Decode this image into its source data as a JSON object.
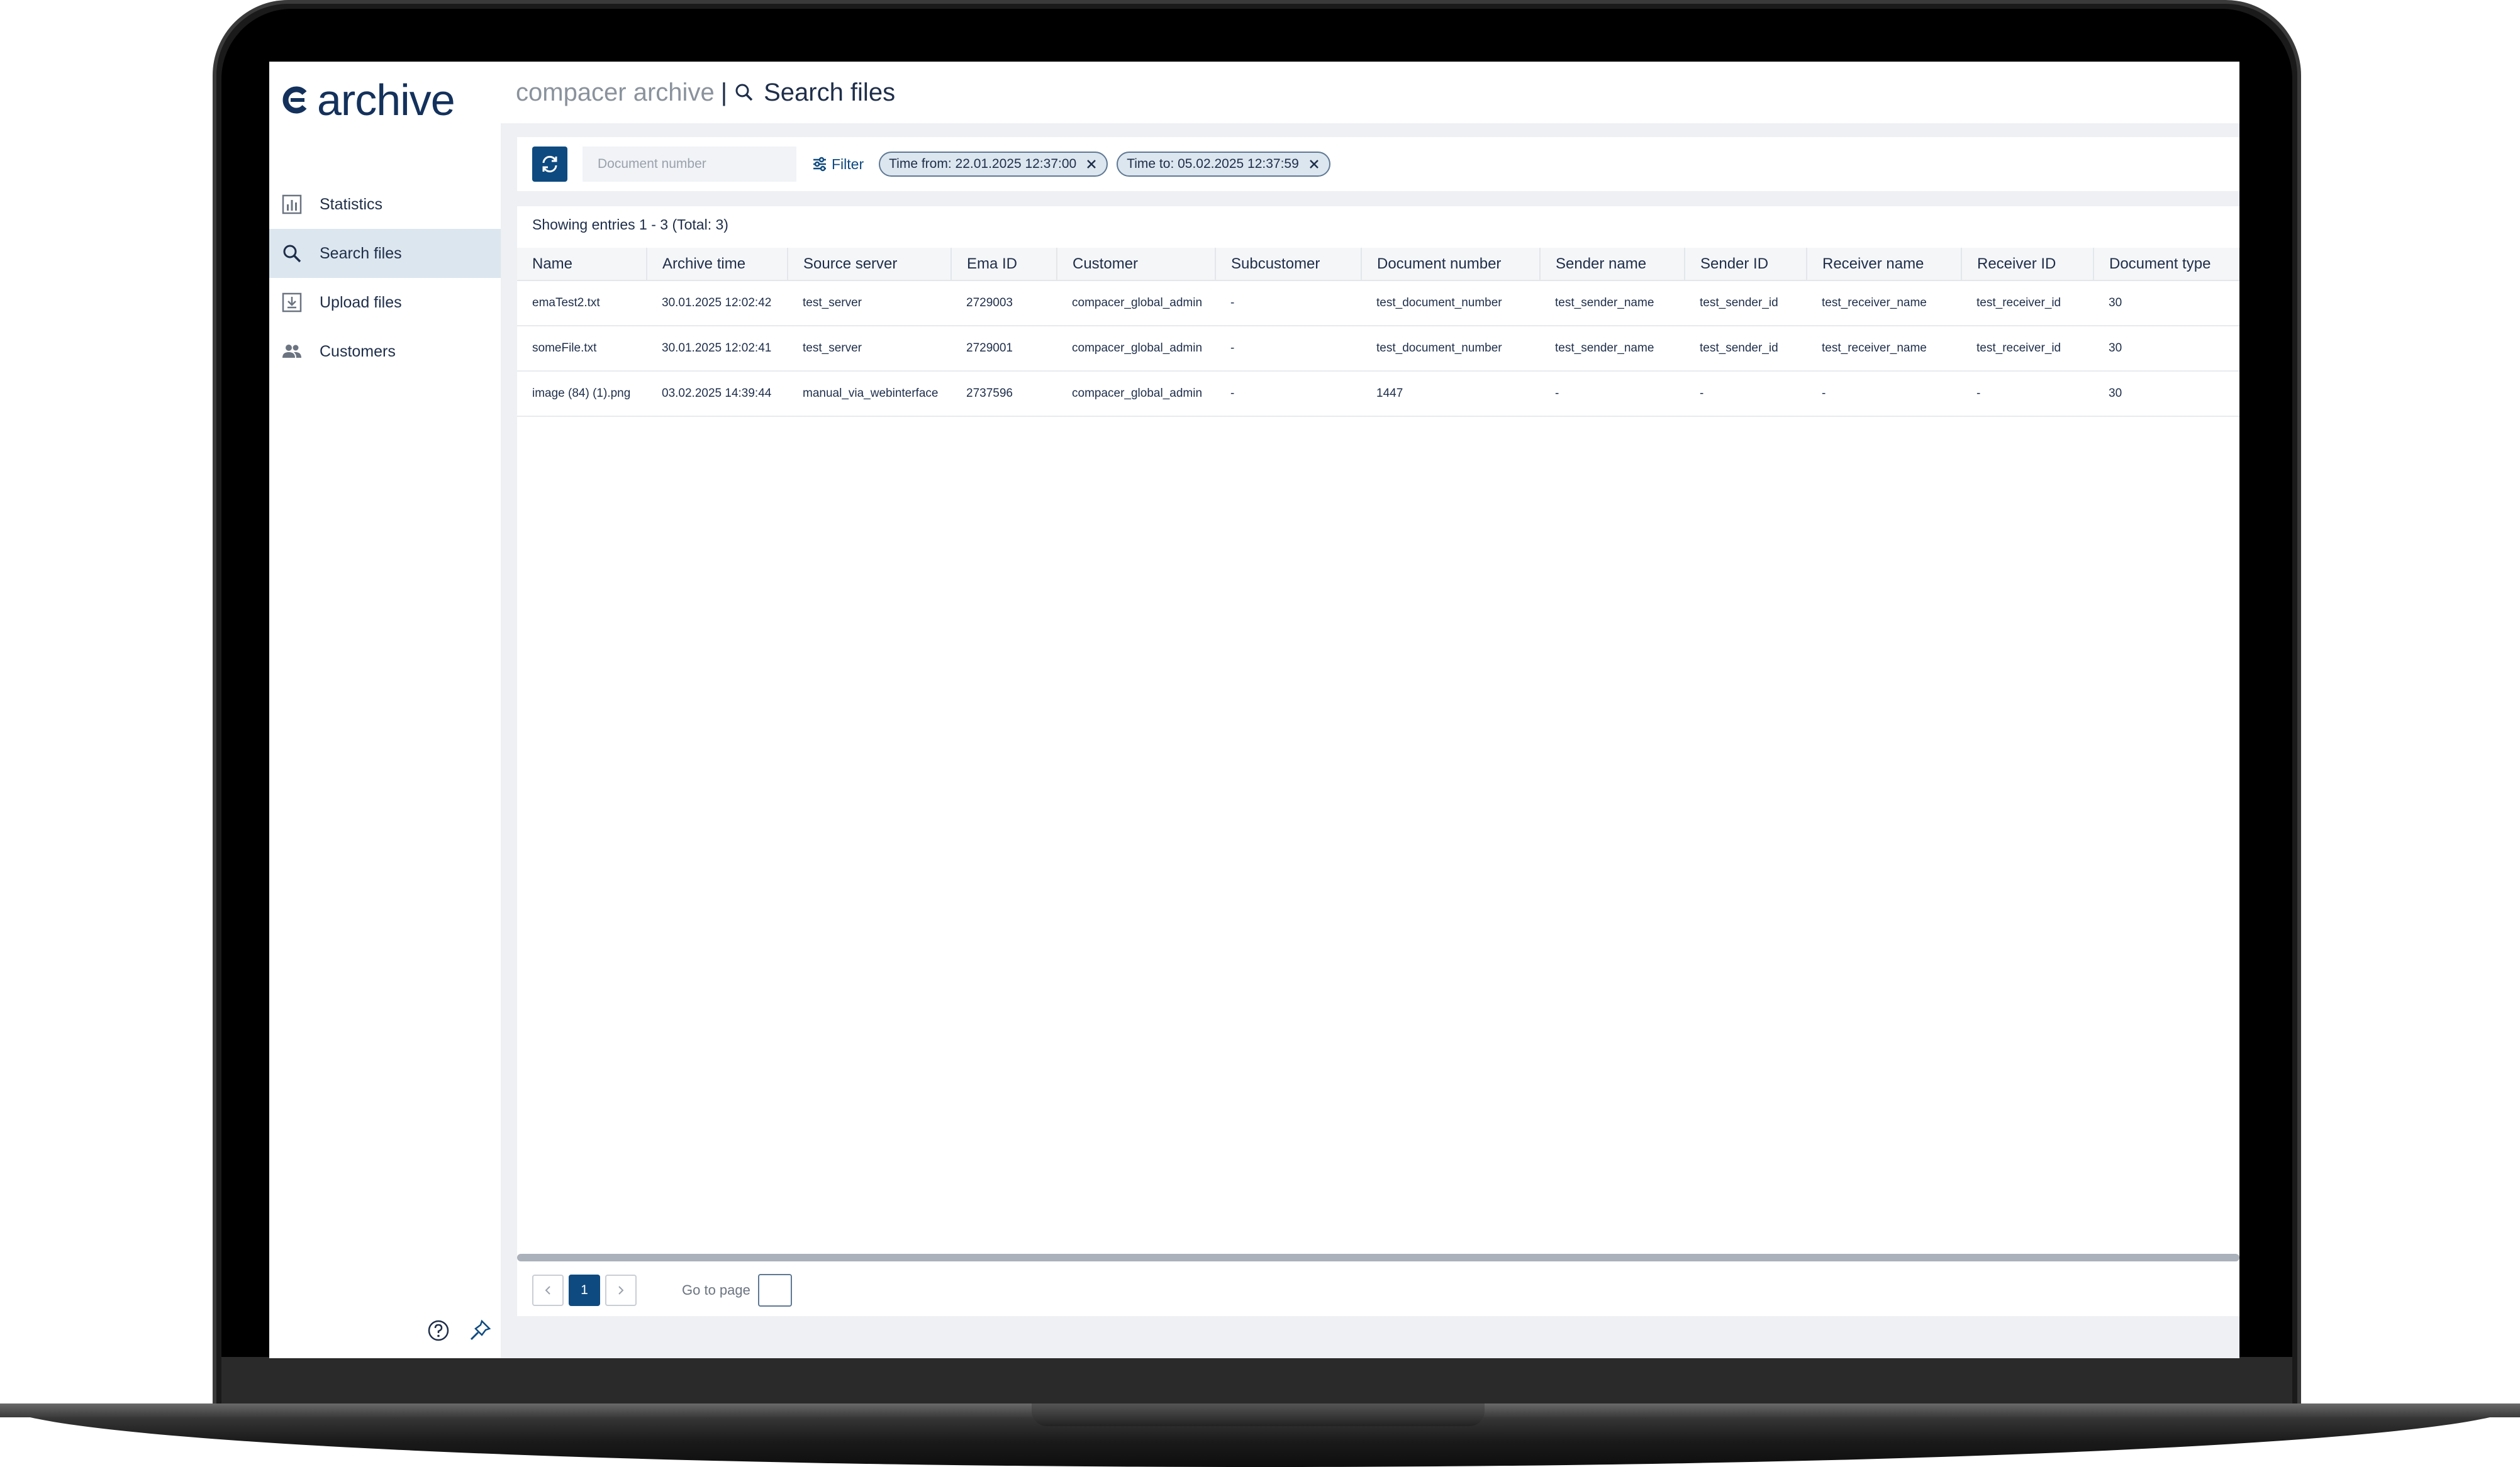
{
  "sidebar": {
    "logo_text": "archive",
    "items": [
      {
        "label": "Statistics",
        "icon": "bar-chart-icon",
        "active": false
      },
      {
        "label": "Search files",
        "icon": "search-icon",
        "active": true
      },
      {
        "label": "Upload files",
        "icon": "upload-icon",
        "active": false
      },
      {
        "label": "Customers",
        "icon": "people-icon",
        "active": false
      }
    ],
    "bottom_icons": [
      "help-icon",
      "pin-icon"
    ]
  },
  "header": {
    "app_name": "compacer archive",
    "separator": "|",
    "page_title": "Search files"
  },
  "filterbar": {
    "document_number_placeholder": "Document number",
    "filter_label": "Filter",
    "chips": [
      {
        "label": "Time from: 22.01.2025 12:37:00"
      },
      {
        "label": "Time to: 05.02.2025 12:37:59"
      }
    ]
  },
  "results": {
    "showing_text": "Showing entries 1 - 3 (Total: 3)",
    "columns": [
      "Name",
      "Archive time",
      "Source server",
      "Ema ID",
      "Customer",
      "Subcustomer",
      "Document number",
      "Sender name",
      "Sender ID",
      "Receiver name",
      "Receiver ID",
      "Document type"
    ],
    "rows": [
      [
        "emaTest2.txt",
        "30.01.2025 12:02:42",
        "test_server",
        "2729003",
        "compacer_global_admin",
        "-",
        "test_document_number",
        "test_sender_name",
        "test_sender_id",
        "test_receiver_name",
        "test_receiver_id",
        "30"
      ],
      [
        "someFile.txt",
        "30.01.2025 12:02:41",
        "test_server",
        "2729001",
        "compacer_global_admin",
        "-",
        "test_document_number",
        "test_sender_name",
        "test_sender_id",
        "test_receiver_name",
        "test_receiver_id",
        "30"
      ],
      [
        "image (84) (1).png",
        "03.02.2025 14:39:44",
        "manual_via_webinterface",
        "2737596",
        "compacer_global_admin",
        "-",
        "1447",
        "-",
        "-",
        "-",
        "-",
        "30"
      ]
    ]
  },
  "pager": {
    "current_page": "1",
    "goto_label": "Go to page"
  },
  "colors": {
    "brand": "#13315c",
    "accent": "#0e4a80",
    "active_nav": "#dce6ef"
  }
}
